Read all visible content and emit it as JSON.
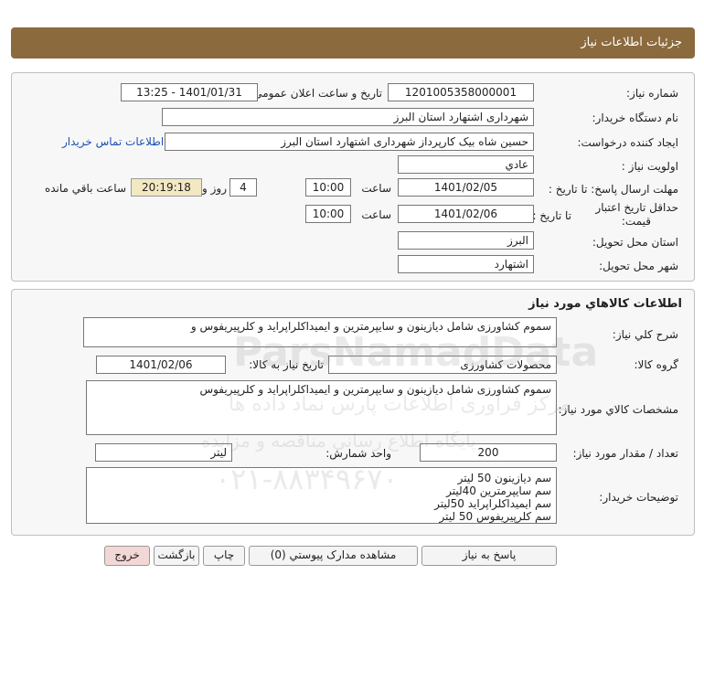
{
  "header": {
    "title": "جزئيات اطلاعات نياز"
  },
  "need_info": {
    "need_number_label": "شماره نياز:",
    "need_number": "1201005358000001",
    "announce_label": "تاريخ و ساعت اعلان عمومی:",
    "announce_value": "1401/01/31 - 13:25",
    "buyer_org_label": "نام دستگاه خريدار:",
    "buyer_org": "شهرداری اشتهارد استان البرز",
    "requester_label": "ايجاد کننده درخواست:",
    "requester": "حسين شاه بيک کارپرداز شهرداری اشتهارد استان البرز",
    "contact_link": "اطلاعات تماس خريدار",
    "priority_label": "اولويت نياز :",
    "priority": "عادي",
    "deadline_label": "مهلت ارسال پاسخ: تا تاریخ :",
    "deadline_date": "1401/02/05",
    "time_label": "ساعت",
    "deadline_time": "10:00",
    "days": "4",
    "days_label": "روز و",
    "remaining_time": "20:19:18",
    "remaining_label": "ساعت باقي مانده",
    "validity_label_1": "حداقل تاريخ اعتبار",
    "validity_label_2": "قيمت:",
    "validity_to_label": "تا تاریخ :",
    "validity_date": "1401/02/06",
    "validity_time": "10:00",
    "province_label": "استان محل تحويل:",
    "province": "البرز",
    "city_label": "شهر محل تحويل:",
    "city": "اشتهارد"
  },
  "goods": {
    "section_title": "اطلاعات کالاهاي مورد نياز",
    "summary_label": "شرح کلي نياز:",
    "summary": "سموم کشاورزی شامل دیازینون و سایپرمترین و ایمیداکلراپراید و کلرپیریفوس و",
    "group_label": "گروه کالا:",
    "group": "محصولات کشاورزی",
    "need_date_label": "تاريخ نياز به کالا:",
    "need_date": "1401/02/06",
    "specs_label": "مشخصات کالاي مورد نياز:",
    "specs": "سموم کشاورزی شامل دیازینون و سایپرمترین و ایمیداکلراپراید و کلرپیریفوس",
    "qty_label": "تعداد / مقدار مورد نياز:",
    "qty": "200",
    "unit_label": "واحد شمارش:",
    "unit": "ليتر",
    "buyer_notes_label": "توضيحات خريدار:",
    "buyer_notes": [
      "سم دیازینون 50 لیتر",
      "سم سایپرمترین  40لیتر",
      "سم ایمیداکلراپراید 50لیتر",
      "سم کلرپیریفوس 50 لیتر"
    ]
  },
  "buttons": {
    "reply": "پاسخ به نياز",
    "attachments": "مشاهده مدارک پيوستي (0)",
    "print": "چاپ",
    "back": "بازگشت",
    "exit": "خروج"
  },
  "watermark": {
    "brand": "ParsNamadData",
    "line1": "مرکز فراوری اطلاعات پارس نماد داده ها",
    "line2": "پایگاه اطلاع رسانی مناقصه و مزایده",
    "phone": "۰۲۱-۸۸۳۴۹۶۷۰"
  },
  "colors": {
    "header": "#8b6a3e",
    "remaining_bg": "#f2e8c2",
    "link": "#1b4fb5",
    "exit_bg": "#f3d7d7"
  }
}
